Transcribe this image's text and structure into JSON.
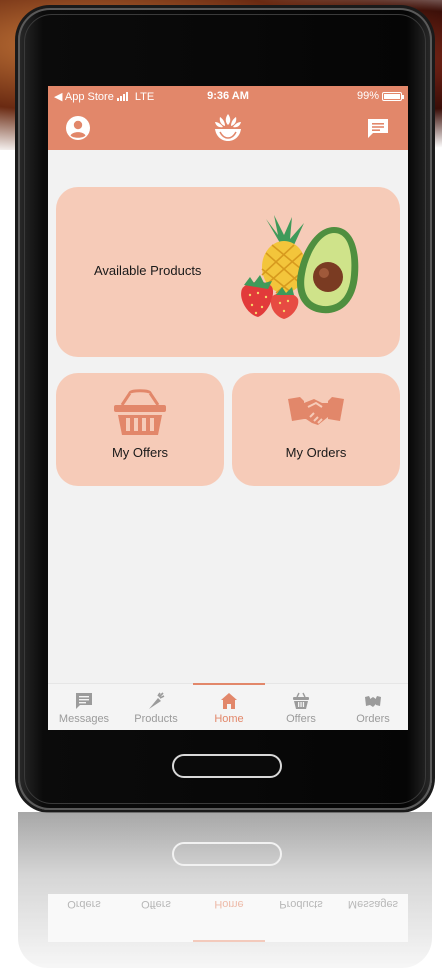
{
  "status_bar": {
    "carrier": "◀ App Store",
    "network": "LTE",
    "time": "9:36 AM",
    "battery": "99%",
    "battery_level": 0.99
  },
  "header": {
    "profile_icon": "account-circle-icon",
    "logo_icon": "lotus-bowl-logo",
    "messages_icon": "chat-bubble-icon"
  },
  "cards": {
    "available_products": "Available Products",
    "my_offers": "My Offers",
    "my_orders": "My Orders"
  },
  "tabs": [
    {
      "label": "Messages",
      "icon": "message-icon"
    },
    {
      "label": "Products",
      "icon": "carrot-icon"
    },
    {
      "label": "Home",
      "icon": "home-icon"
    },
    {
      "label": "Offers",
      "icon": "basket-icon"
    },
    {
      "label": "Orders",
      "icon": "handshake-icon"
    }
  ],
  "active_tab": "Home",
  "colors": {
    "accent": "#e2876a",
    "card": "#f6cbb8",
    "screen_bg": "#f2f2f2"
  }
}
